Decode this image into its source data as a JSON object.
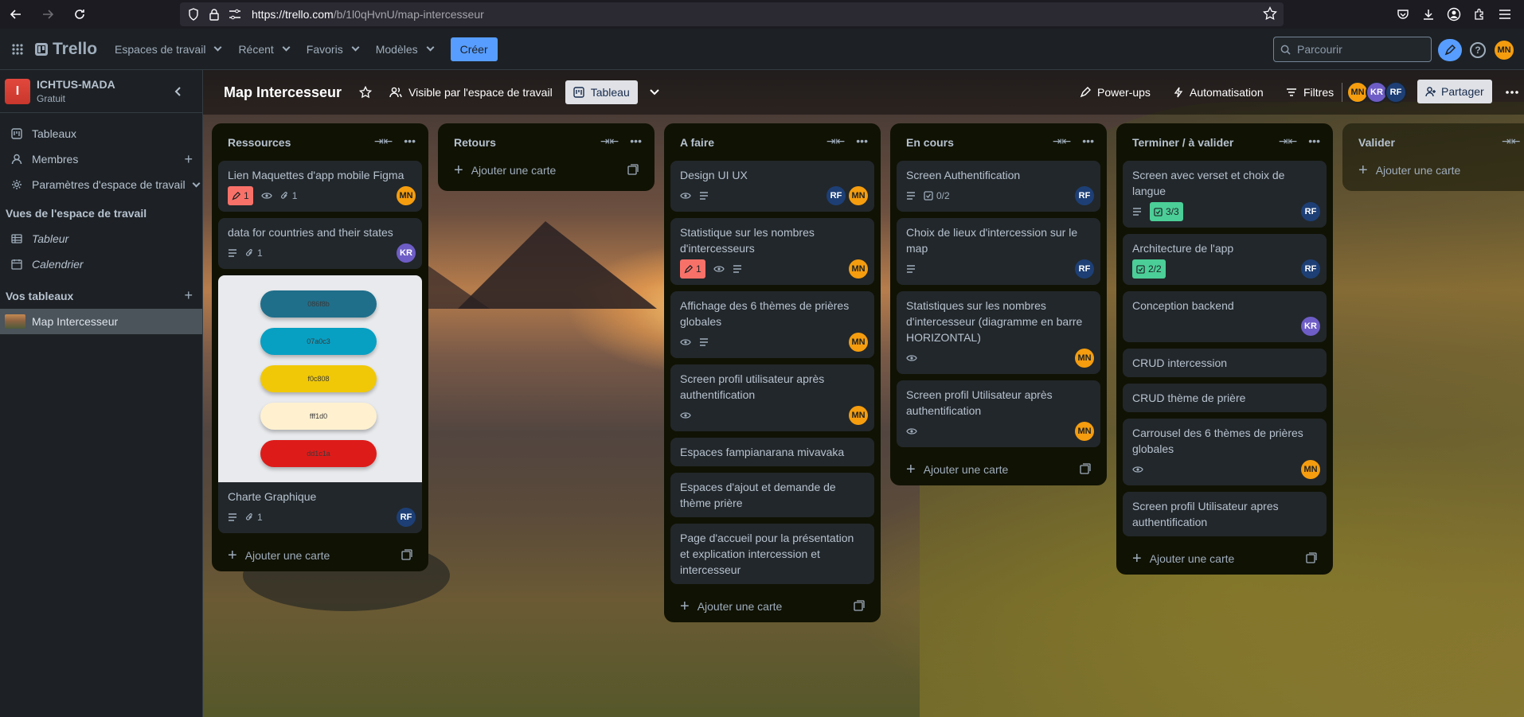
{
  "browser": {
    "url_host": "https://trello.com",
    "url_path": "/b/1l0qHvnU/map-intercesseur"
  },
  "header": {
    "logo": "Trello",
    "menu": [
      "Espaces de travail",
      "Récent",
      "Favoris",
      "Modèles"
    ],
    "create_label": "Créer",
    "search_placeholder": "Parcourir",
    "user_initials": "MN"
  },
  "sidebar": {
    "workspace_initial": "I",
    "workspace_name": "ICHTUS-MADA",
    "workspace_plan": "Gratuit",
    "items": [
      {
        "label": "Tableaux",
        "icon": "board-icon"
      },
      {
        "label": "Membres",
        "icon": "person-icon"
      },
      {
        "label": "Paramètres d'espace de travail",
        "icon": "gear-icon"
      }
    ],
    "views_title": "Vues de l'espace de travail",
    "views": [
      {
        "label": "Tableur",
        "icon": "table-icon"
      },
      {
        "label": "Calendrier",
        "icon": "calendar-icon"
      }
    ],
    "boards_title": "Vos tableaux",
    "boards": [
      {
        "label": "Map Intercesseur"
      }
    ]
  },
  "board_header": {
    "title": "Map Intercesseur",
    "visibility": "Visible par l'espace de travail",
    "view": "Tableau",
    "powerups": "Power-ups",
    "automation": "Automatisation",
    "filters": "Filtres",
    "members": [
      "MN",
      "KR",
      "RF"
    ],
    "share": "Partager"
  },
  "lists": [
    {
      "title": "Ressources",
      "add_label": "Ajouter une carte",
      "cards": [
        {
          "title": "Lien Maquettes d'app mobile Figma",
          "badge_red": "1",
          "attachments": "1",
          "members": [
            "MN"
          ]
        },
        {
          "title": "data for countries and their states",
          "attachments": "1",
          "members": [
            "KR"
          ]
        },
        {
          "title": "Charte Graphique",
          "attachments": "1",
          "members": [
            "RF"
          ],
          "swatches": [
            {
              "label": "086f8b",
              "color": "#1f6f8b"
            },
            {
              "label": "07a0c3",
              "color": "#07a0c3"
            },
            {
              "label": "f0c808",
              "color": "#f0c808"
            },
            {
              "label": "fff1d0",
              "color": "#fff1d0"
            },
            {
              "label": "dd1c1a",
              "color": "#dd1c1a"
            }
          ]
        }
      ]
    },
    {
      "title": "Retours",
      "add_label": "Ajouter une carte",
      "cards": []
    },
    {
      "title": "A faire",
      "add_label": "Ajouter une carte",
      "cards": [
        {
          "title": "Design UI UX",
          "members": [
            "RF",
            "MN"
          ]
        },
        {
          "title": "Statistique sur les nombres d'intercesseurs",
          "badge_red": "1",
          "members": [
            "MN"
          ]
        },
        {
          "title": "Affichage des 6 thèmes de prières globales",
          "members": [
            "MN"
          ]
        },
        {
          "title": "Screen profil utilisateur après authentification",
          "members": [
            "MN"
          ]
        },
        {
          "title": "Espaces fampianarana mivavaka"
        },
        {
          "title": "Espaces d'ajout et demande de thème prière"
        },
        {
          "title": "Page d'accueil pour la présentation et explication intercession et intercesseur"
        }
      ]
    },
    {
      "title": "En cours",
      "add_label": "Ajouter une carte",
      "cards": [
        {
          "title": "Screen Authentification",
          "checklist": "0/2",
          "members": [
            "RF"
          ]
        },
        {
          "title": "Choix de lieux d'intercession sur le map",
          "members": [
            "RF"
          ]
        },
        {
          "title": "Statistiques sur les nombres d'intercesseur (diagramme en barre HORIZONTAL)",
          "members": [
            "MN"
          ]
        },
        {
          "title": "Screen profil Utilisateur après authentification",
          "members": [
            "MN"
          ]
        }
      ]
    },
    {
      "title": "Terminer / à valider",
      "add_label": "Ajouter une carte",
      "cards": [
        {
          "title": "Screen avec verset et choix de langue",
          "checklist": "3/3",
          "members": [
            "RF"
          ]
        },
        {
          "title": "Architecture de l'app",
          "checklist": "2/2",
          "members": [
            "RF"
          ]
        },
        {
          "title": "Conception backend",
          "members": [
            "KR"
          ]
        },
        {
          "title": "CRUD intercession"
        },
        {
          "title": "CRUD thème de prière"
        },
        {
          "title": "Carrousel des 6 thèmes de prières globales",
          "members": [
            "MN"
          ]
        },
        {
          "title": "Screen profil Utilisateur apres authentification"
        }
      ]
    },
    {
      "title": "Valider",
      "add_label": "Ajouter une carte",
      "cards": []
    }
  ]
}
